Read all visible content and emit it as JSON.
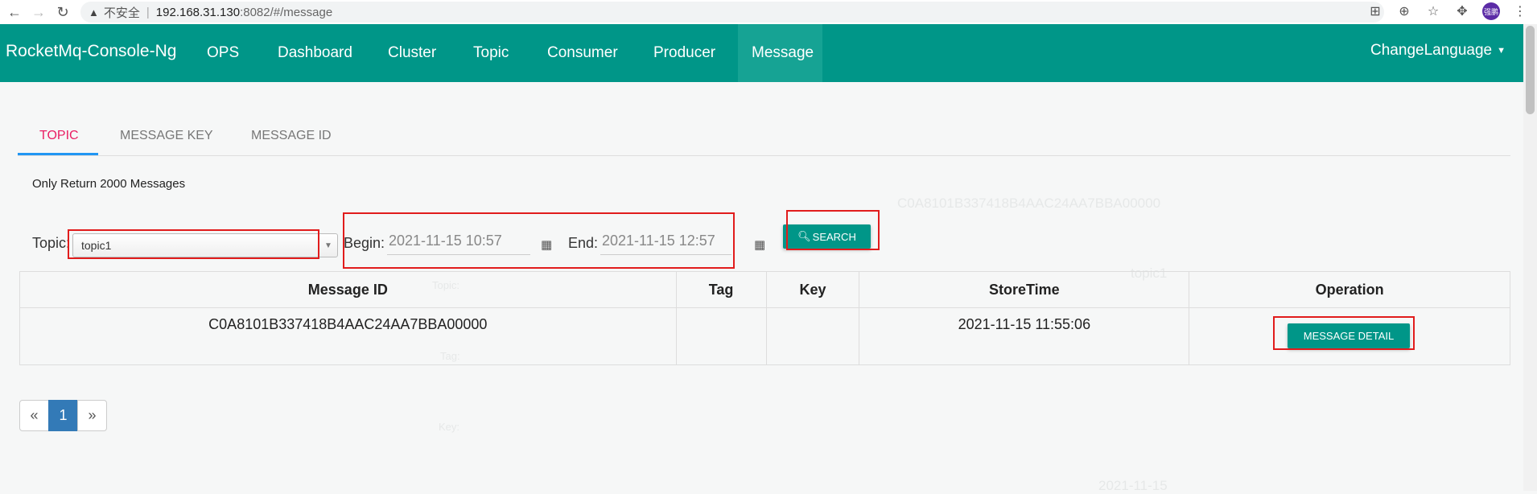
{
  "browser": {
    "insecure_label": "不安全",
    "host": "192.168.31.130",
    "path": ":8082/#/message",
    "avatar_text": "强鹏"
  },
  "navbar": {
    "brand": "RocketMq-Console-Ng",
    "items": [
      "OPS",
      "Dashboard",
      "Cluster",
      "Topic",
      "Consumer",
      "Producer",
      "Message"
    ],
    "active": "Message",
    "language": "ChangeLanguage",
    "color": "#009688"
  },
  "tabs": {
    "items": [
      "TOPIC",
      "MESSAGE KEY",
      "MESSAGE ID"
    ],
    "active": "TOPIC"
  },
  "info": "Only Return 2000 Messages",
  "form": {
    "topic_label": "Topic:",
    "topic_value": "topic1",
    "begin_label": "Begin:",
    "begin_value": "2021-11-15 10:57",
    "end_label": "End:",
    "end_value": "2021-11-15 12:57",
    "search_label": "SEARCH"
  },
  "table": {
    "headers": [
      "Message ID",
      "Tag",
      "Key",
      "StoreTime",
      "Operation"
    ],
    "rows": [
      {
        "message_id": "C0A8101B337418B4AAC24AA7BBA00000",
        "tag": "",
        "key": "",
        "store_time": "2021-11-15 11:55:06",
        "operation": "MESSAGE DETAIL"
      }
    ]
  },
  "pagination": {
    "prev": "«",
    "current": "1",
    "next": "»"
  },
  "ghost": {
    "msg_id": "C0A8101B337418B4AAC24AA7BBA00000",
    "topic_key": "Topic:",
    "topic_val": "topic1",
    "tag_key": "Tag:",
    "key_key": "Key:",
    "date": "2021-11-15"
  }
}
